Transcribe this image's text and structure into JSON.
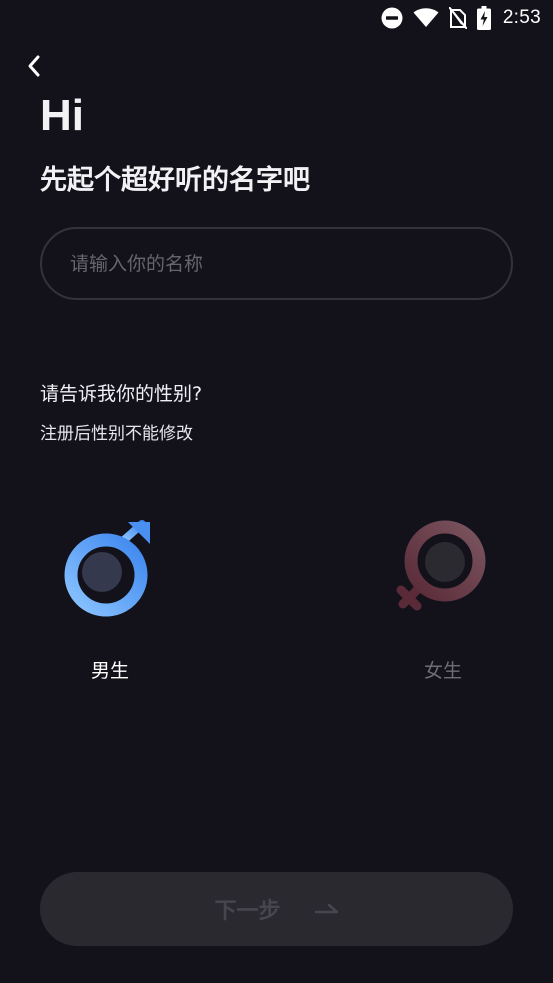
{
  "status_bar": {
    "time": "2:53"
  },
  "header": {
    "greeting": "Hi",
    "subtitle": "先起个超好听的名字吧"
  },
  "name_field": {
    "placeholder": "请输入你的名称",
    "value": ""
  },
  "gender": {
    "question": "请告诉我你的性别?",
    "note": "注册后性别不能修改",
    "options": [
      {
        "label": "男生",
        "icon": "male-symbol-icon",
        "selected": true,
        "color": "#5aa2f8"
      },
      {
        "label": "女生",
        "icon": "female-symbol-icon",
        "selected": false,
        "color": "#6a3a4a"
      }
    ]
  },
  "next_button": {
    "label": "下一步",
    "icon": "arrow-right-icon"
  },
  "colors": {
    "background": "#13121a",
    "input_border": "#34333d",
    "button_bg": "#2a2930",
    "male_accent": "#5aa2f8",
    "female_accent": "#6a3a4a"
  }
}
